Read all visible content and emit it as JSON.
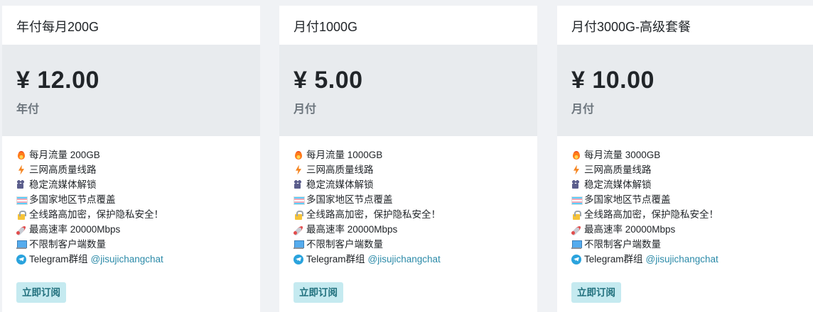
{
  "plans": [
    {
      "title": "年付每月200G",
      "price": "¥ 12.00",
      "period": "年付",
      "features": [
        {
          "icon": "fire-icon",
          "text": "每月流量 200GB"
        },
        {
          "icon": "lightning-icon",
          "text": "三网高质量线路"
        },
        {
          "icon": "film-camera-icon",
          "text": "稳定流媒体解锁"
        },
        {
          "icon": "flag-icon",
          "text": "多国家地区节点覆盖"
        },
        {
          "icon": "lock-icon",
          "text": "全线路高加密，保护隐私安全！"
        },
        {
          "icon": "rocket-icon",
          "text": "最高速率 20000Mbps"
        },
        {
          "icon": "laptop-icon",
          "text": "不限制客户端数量"
        }
      ],
      "telegram_label": "Telegram群组",
      "telegram_link": "@jisujichangchat",
      "button_label": "立即订阅"
    },
    {
      "title": "月付1000G",
      "price": "¥ 5.00",
      "period": "月付",
      "features": [
        {
          "icon": "fire-icon",
          "text": "每月流量 1000GB"
        },
        {
          "icon": "lightning-icon",
          "text": "三网高质量线路"
        },
        {
          "icon": "film-camera-icon",
          "text": "稳定流媒体解锁"
        },
        {
          "icon": "flag-icon",
          "text": "多国家地区节点覆盖"
        },
        {
          "icon": "lock-icon",
          "text": "全线路高加密，保护隐私安全！"
        },
        {
          "icon": "rocket-icon",
          "text": "最高速率 20000Mbps"
        },
        {
          "icon": "laptop-icon",
          "text": "不限制客户端数量"
        }
      ],
      "telegram_label": "Telegram群组",
      "telegram_link": "@jisujichangchat",
      "button_label": "立即订阅"
    },
    {
      "title": "月付3000G-高级套餐",
      "price": "¥ 10.00",
      "period": "月付",
      "features": [
        {
          "icon": "fire-icon",
          "text": "每月流量 3000GB"
        },
        {
          "icon": "lightning-icon",
          "text": "三网高质量线路"
        },
        {
          "icon": "film-camera-icon",
          "text": "稳定流媒体解锁"
        },
        {
          "icon": "flag-icon",
          "text": "多国家地区节点覆盖"
        },
        {
          "icon": "lock-icon",
          "text": "全线路高加密，保护隐私安全！"
        },
        {
          "icon": "rocket-icon",
          "text": "最高速率 20000Mbps"
        },
        {
          "icon": "laptop-icon",
          "text": "不限制客户端数量"
        }
      ],
      "telegram_label": "Telegram群组",
      "telegram_link": "@jisujichangchat",
      "button_label": "立即订阅"
    }
  ],
  "colors": {
    "page_bg": "#f0f2f5",
    "price_bg": "#e8ebee",
    "button_bg": "#c5eaf0",
    "button_text": "#1f6f7c",
    "link": "#2b8aa8"
  }
}
